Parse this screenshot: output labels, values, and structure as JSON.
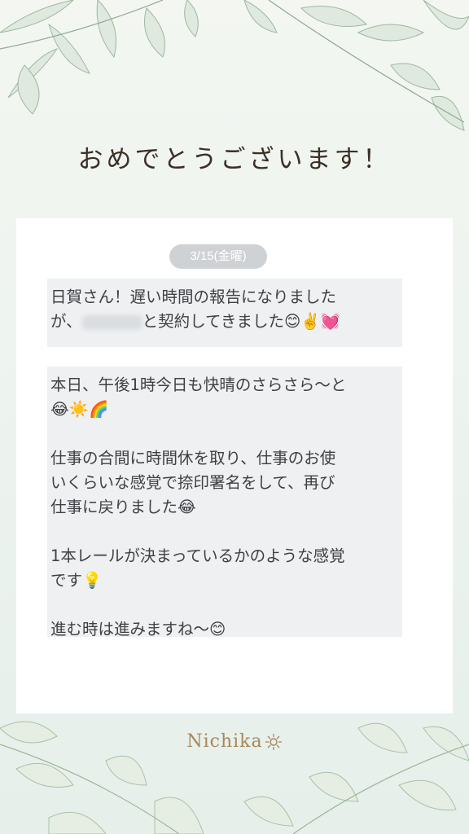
{
  "title": "おめでとうございます！",
  "date_badge": "3/15(金曜)",
  "message1": {
    "line1": "日賀さん！遅い時間の報告になりました",
    "line2_prefix": "が、",
    "line2_suffix": "と契約してきました😊✌️💓"
  },
  "message2": {
    "p1_line1": "本日、午後1時今日も快晴のさらさら〜と",
    "p1_line2": "😂☀️🌈",
    "p2_line1": "仕事の合間に時間休を取り、仕事のお使",
    "p2_line2": "いくらいな感覚で捺印署名をして、再び",
    "p2_line3": "仕事に戻りました😂",
    "p3_line1": "1本レールが決まっているかのような感覚",
    "p3_line2": "です💡",
    "p4_line1": "進む時は進みますね〜😊"
  },
  "brand": "Nichika",
  "colors": {
    "title": "#3b2f26",
    "brand": "#a7885a",
    "bubble": "#eff0f2",
    "pill": "#cfd2d5"
  },
  "icons": {
    "decor_top": "leaf-branches-icon",
    "decor_bottom": "leaf-branches-icon",
    "brand_mark": "sun-icon"
  }
}
